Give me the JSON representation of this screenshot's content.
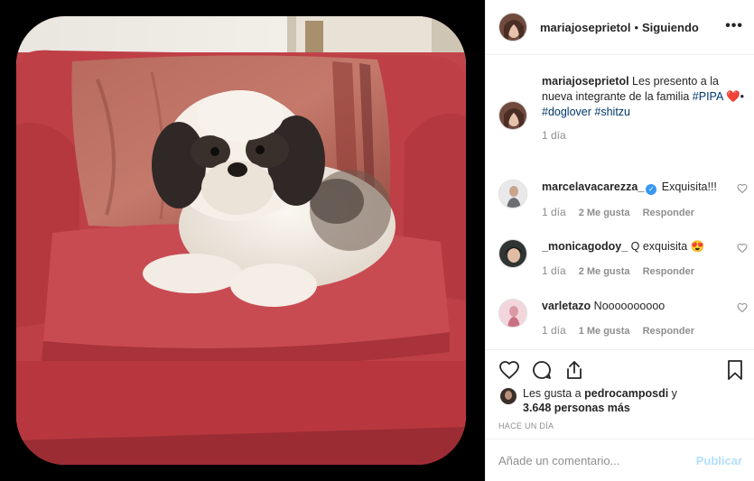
{
  "header": {
    "username": "mariajoseprietol",
    "separator": "•",
    "follow_status": "Siguiendo",
    "more_icon": "more-horizontal-icon",
    "more_label": "•••"
  },
  "caption": {
    "username": "mariajoseprietol",
    "text": " Les presento a la nueva integrante de la familia ",
    "hashtag1": "#PIPA",
    "text2": " ❤️•",
    "hashtag2": "#doglover",
    "hashtag3": "#shitzu",
    "time": "1 día"
  },
  "comments": [
    {
      "username": "marcelavacarezza_",
      "verified": true,
      "text": " Exquisita!!!",
      "time": "1 día",
      "likes": "2 Me gusta",
      "reply": "Responder"
    },
    {
      "username": "_monicagodoy_",
      "verified": false,
      "text": " Q exquisita 😍",
      "time": "1 día",
      "likes": "2 Me gusta",
      "reply": "Responder"
    },
    {
      "username": "varletazo",
      "verified": false,
      "text": " Noooooooooo",
      "time": "1 día",
      "likes": "1 Me gusta",
      "reply": "Responder"
    }
  ],
  "actions": {
    "icons": [
      "heart-icon",
      "comment-icon",
      "share-icon",
      "bookmark-icon"
    ]
  },
  "likes": {
    "prefix": "Les gusta a ",
    "user": "pedrocamposdi",
    "middle": " y ",
    "count": "3.648 personas más"
  },
  "timeago": "HACE UN DÍA",
  "add_comment": {
    "placeholder": "Añade un comentario...",
    "publish_label": "Publicar"
  },
  "colors": {
    "link": "#00376b",
    "muted": "#8e8e8e",
    "verified": "#3897f0",
    "publish_disabled": "#b2dffc"
  }
}
